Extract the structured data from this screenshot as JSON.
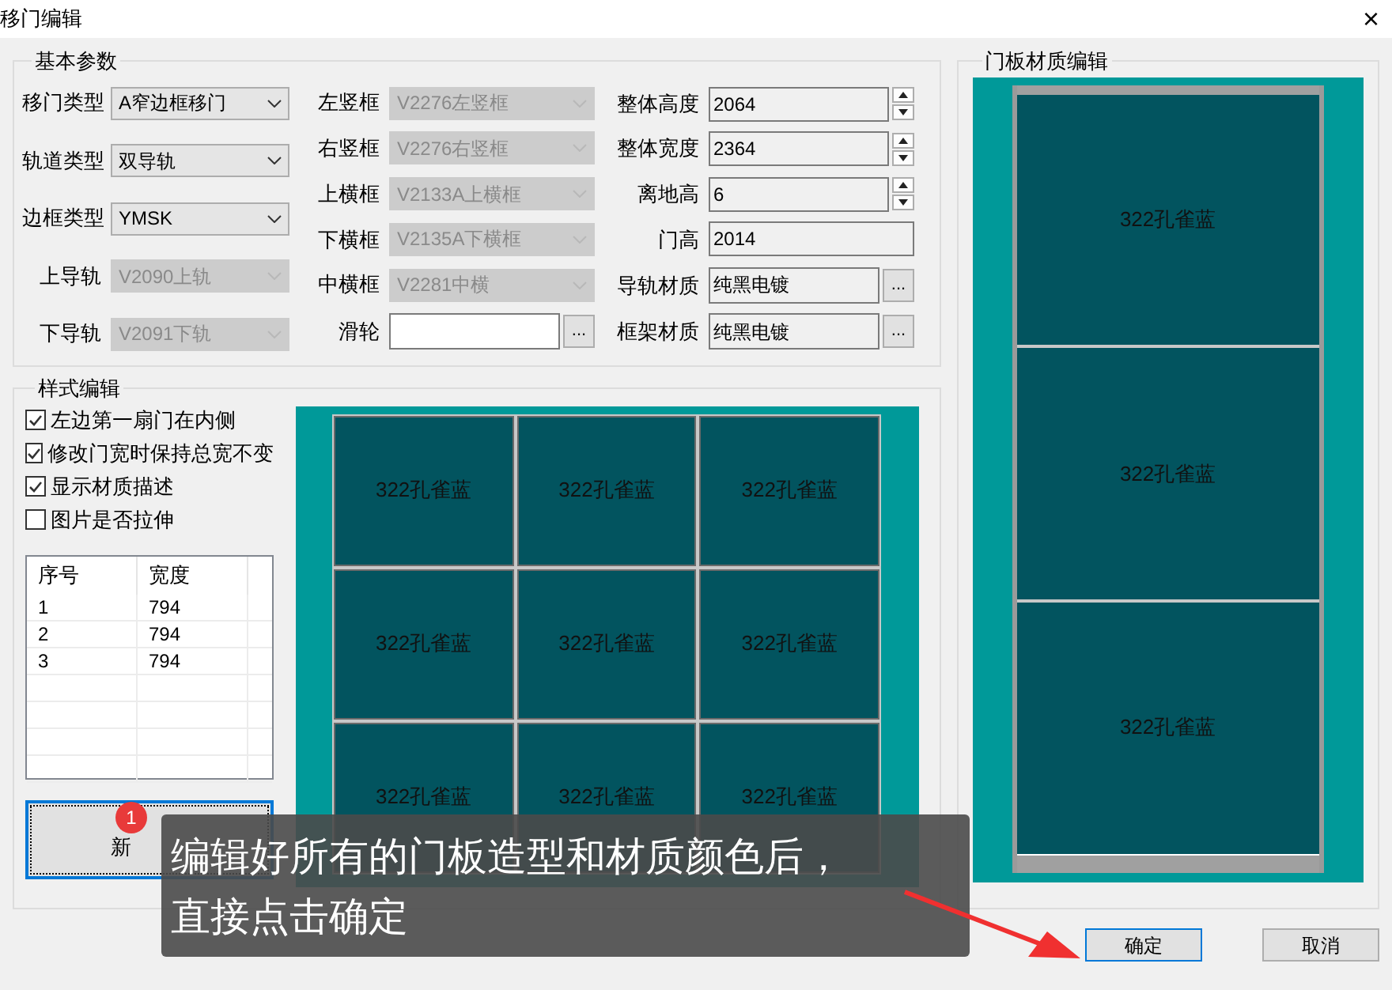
{
  "window": {
    "title": "移门编辑",
    "close": "×"
  },
  "basic_params": {
    "title": "基本参数",
    "columns": [
      [
        {
          "kind": "select",
          "label": "移门类型",
          "value": "A窄边框移门",
          "disabled": false
        },
        {
          "kind": "select",
          "label": "轨道类型",
          "value": "双导轨",
          "disabled": false
        },
        {
          "kind": "select",
          "label": "边框类型",
          "value": "YMSK",
          "disabled": false
        },
        {
          "kind": "select",
          "label": "上导轨",
          "value": "V2090上轨",
          "disabled": true
        },
        {
          "kind": "select",
          "label": "下导轨",
          "value": "V2091下轨",
          "disabled": true
        }
      ],
      [
        {
          "kind": "select",
          "label": "左竖框",
          "value": "V2276左竖框",
          "disabled": true
        },
        {
          "kind": "select",
          "label": "右竖框",
          "value": "V2276右竖框",
          "disabled": true
        },
        {
          "kind": "select",
          "label": "上横框",
          "value": "V2133A上横框",
          "disabled": true
        },
        {
          "kind": "select",
          "label": "下横框",
          "value": "V2135A下横框",
          "disabled": true
        },
        {
          "kind": "select",
          "label": "中横框",
          "value": "V2281中横",
          "disabled": true
        },
        {
          "kind": "browse",
          "label": "滑轮",
          "button": "..."
        }
      ],
      [
        {
          "kind": "spin",
          "label": "整体高度",
          "value": "2064"
        },
        {
          "kind": "spin",
          "label": "整体宽度",
          "value": "2364"
        },
        {
          "kind": "spin",
          "label": "离地高",
          "value": "6"
        },
        {
          "kind": "text",
          "label": "门高",
          "value": "2014"
        },
        {
          "kind": "browse",
          "label": "导轨材质",
          "value": "纯黑电镀",
          "button": "..."
        },
        {
          "kind": "browse",
          "label": "框架材质",
          "value": "纯黑电镀",
          "button": "..."
        }
      ]
    ]
  },
  "style_edit": {
    "title": "样式编辑",
    "options": [
      {
        "label": "左边第一扇门在内侧",
        "checked": true
      },
      {
        "label": "修改门宽时保持总宽不变",
        "checked": true
      },
      {
        "label": "显示材质描述",
        "checked": true
      },
      {
        "label": "图片是否拉伸",
        "checked": false
      }
    ],
    "table": {
      "columns": [
        "序号",
        "宽度"
      ],
      "rows": [
        [
          "1",
          "794"
        ],
        [
          "2",
          "794"
        ],
        [
          "3",
          "794"
        ]
      ]
    },
    "new_button": "新",
    "preview_rows": [
      [
        "322孔雀蓝",
        "322孔雀蓝",
        "322孔雀蓝"
      ],
      [
        "322孔雀蓝",
        "322孔雀蓝",
        "322孔雀蓝"
      ],
      [
        "322孔雀蓝",
        "322孔雀蓝",
        "322孔雀蓝"
      ]
    ]
  },
  "panel_material": {
    "title": "门板材质编辑",
    "panels": [
      "322孔雀蓝",
      "322孔雀蓝",
      "322孔雀蓝"
    ]
  },
  "buttons": [
    {
      "label": "确定",
      "focused": true
    },
    {
      "label": "取消",
      "focused": false
    }
  ],
  "tip": {
    "badge": "1",
    "lines": [
      "编辑好所有的门板造型和材质颜色后，",
      "直接点击确定"
    ]
  }
}
